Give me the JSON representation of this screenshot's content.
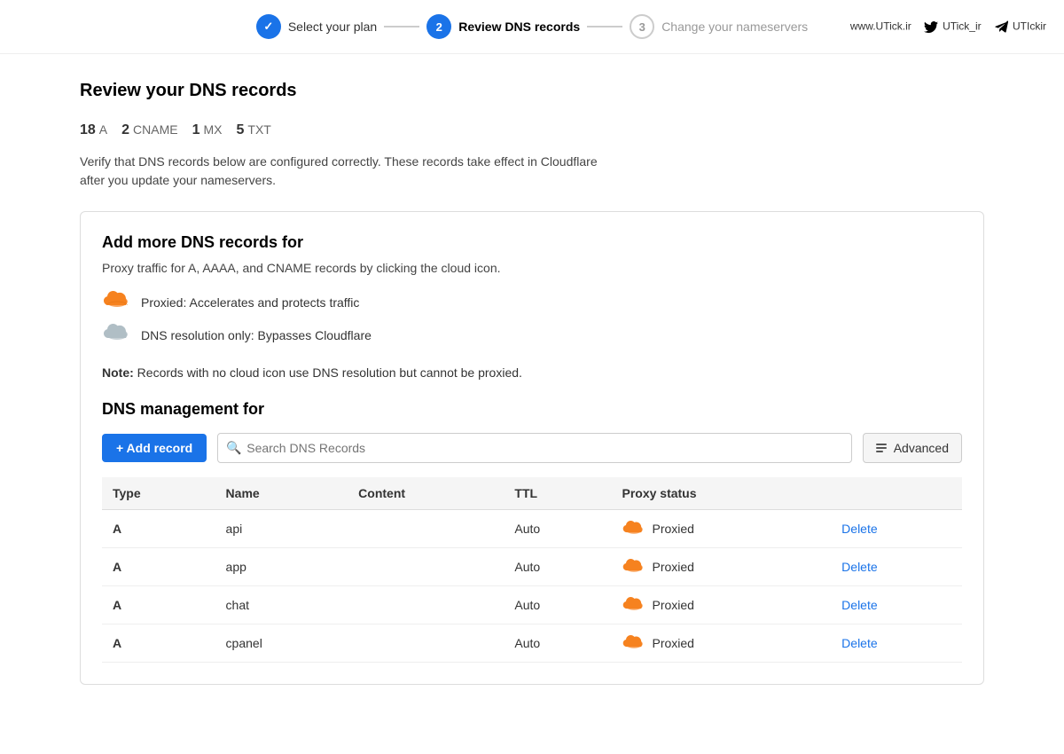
{
  "header": {
    "watermark_url": "www.UTick.ir",
    "watermark_twitter": "UTick_ir",
    "watermark_telegram": "UTIckir"
  },
  "stepper": {
    "steps": [
      {
        "id": "select-plan",
        "number": "✓",
        "label": "Select your plan",
        "state": "completed"
      },
      {
        "id": "review-dns",
        "number": "2",
        "label": "Review DNS records",
        "state": "active"
      },
      {
        "id": "change-nameservers",
        "number": "3",
        "label": "Change your nameservers",
        "state": "inactive"
      }
    ]
  },
  "page": {
    "title": "Review your DNS records",
    "record_counts": [
      {
        "num": "18",
        "type": "A"
      },
      {
        "num": "2",
        "type": "CNAME"
      },
      {
        "num": "1",
        "type": "MX"
      },
      {
        "num": "5",
        "type": "TXT"
      }
    ],
    "verify_text": "Verify that DNS records below are configured correctly. These records take effect in Cloudflare after you update your nameservers."
  },
  "card": {
    "title": "Add more DNS records for",
    "subtitle": "Proxy traffic for A, AAAA, and CNAME records by clicking the cloud icon.",
    "proxy_items": [
      {
        "id": "proxied",
        "icon": "orange-cloud",
        "text": "Proxied: Accelerates and protects traffic"
      },
      {
        "id": "dns-only",
        "icon": "gray-cloud",
        "text": "DNS resolution only: Bypasses Cloudflare"
      }
    ],
    "note": "Note:",
    "note_text": " Records with no cloud icon use DNS resolution but cannot be proxied.",
    "dns_mgmt_title": "DNS management for",
    "toolbar": {
      "add_record_label": "+ Add record",
      "search_placeholder": "Search DNS Records",
      "advanced_label": "Advanced"
    },
    "table": {
      "headers": [
        "Type",
        "Name",
        "Content",
        "TTL",
        "Proxy status",
        ""
      ],
      "rows": [
        {
          "type": "A",
          "name": "api",
          "content": "",
          "ttl": "Auto",
          "proxy": "Proxied",
          "action": "Delete"
        },
        {
          "type": "A",
          "name": "app",
          "content": "",
          "ttl": "Auto",
          "proxy": "Proxied",
          "action": "Delete"
        },
        {
          "type": "A",
          "name": "chat",
          "content": "",
          "ttl": "Auto",
          "proxy": "Proxied",
          "action": "Delete"
        },
        {
          "type": "A",
          "name": "cpanel",
          "content": "",
          "ttl": "Auto",
          "proxy": "Proxied",
          "action": "Delete"
        }
      ]
    }
  }
}
